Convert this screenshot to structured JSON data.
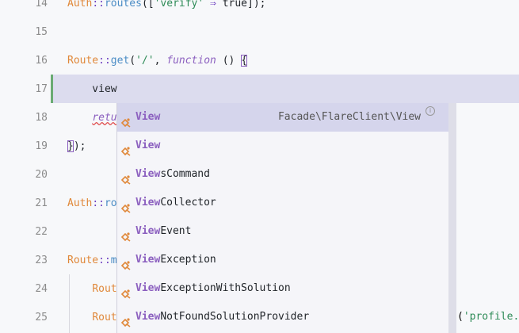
{
  "editor": {
    "lines": [
      {
        "num": "14",
        "parts": [
          [
            "kw",
            "Auth"
          ],
          [
            "op",
            "::"
          ],
          [
            "fn",
            "routes"
          ],
          [
            "plain",
            "(["
          ],
          [
            "str",
            "'verify'"
          ],
          [
            "op",
            " ⇒ "
          ],
          [
            "bool",
            "true"
          ],
          [
            "plain",
            "]);"
          ]
        ]
      },
      {
        "num": "15",
        "parts": []
      },
      {
        "num": "16",
        "parts": [
          [
            "kw",
            "Route"
          ],
          [
            "op",
            "::"
          ],
          [
            "fn",
            "get"
          ],
          [
            "plain",
            "("
          ],
          [
            "str",
            "'/'"
          ],
          [
            "plain",
            ", "
          ],
          [
            "it",
            "function"
          ],
          [
            "plain",
            " () "
          ],
          [
            "brace",
            "{"
          ]
        ]
      },
      {
        "num": "17",
        "parts": [
          [
            "plain",
            "    view"
          ]
        ]
      },
      {
        "num": "18",
        "parts": [
          [
            "plain",
            "    "
          ],
          [
            "ret",
            "retu"
          ]
        ]
      },
      {
        "num": "19",
        "parts": [
          [
            "brace",
            "}"
          ],
          [
            "plain",
            ");"
          ]
        ]
      },
      {
        "num": "20",
        "parts": []
      },
      {
        "num": "21",
        "parts": [
          [
            "kw",
            "Auth"
          ],
          [
            "op",
            "::"
          ],
          [
            "fn",
            "ro"
          ]
        ]
      },
      {
        "num": "22",
        "parts": []
      },
      {
        "num": "23",
        "parts": [
          [
            "kw",
            "Route"
          ],
          [
            "op",
            "::"
          ],
          [
            "fn",
            "m"
          ]
        ]
      },
      {
        "num": "24",
        "parts": [
          [
            "plain",
            "    "
          ],
          [
            "kw",
            "Rout"
          ]
        ]
      },
      {
        "num": "25",
        "parts": [
          [
            "plain",
            "    "
          ],
          [
            "kw",
            "Rout"
          ]
        ]
      }
    ],
    "right_fragment_paren": "(",
    "right_fragment_str": "'profile."
  },
  "completion": {
    "items": [
      {
        "match": "View",
        "rest": "",
        "detail": "Facade\\FlareClient\\View",
        "selected": true
      },
      {
        "match": "View",
        "rest": "",
        "detail": "",
        "selected": false
      },
      {
        "match": "View",
        "rest": "sCommand",
        "detail": "",
        "selected": false
      },
      {
        "match": "View",
        "rest": "Collector",
        "detail": "",
        "selected": false
      },
      {
        "match": "View",
        "rest": "Event",
        "detail": "",
        "selected": false
      },
      {
        "match": "View",
        "rest": "Exception",
        "detail": "",
        "selected": false
      },
      {
        "match": "View",
        "rest": "ExceptionWithSolution",
        "detail": "",
        "selected": false
      },
      {
        "match": "View",
        "rest": "NotFoundSolutionProvider",
        "detail": "",
        "selected": false
      }
    ],
    "item_icon": "class-icon",
    "info_icon": "info-icon",
    "info_glyph": "i"
  },
  "colors": {
    "current_line": "#dcdcee",
    "selected_item": "#d5d5ec",
    "match": "#8b5fbf",
    "class_name": "#e0883a",
    "modified": "#6aab73"
  }
}
